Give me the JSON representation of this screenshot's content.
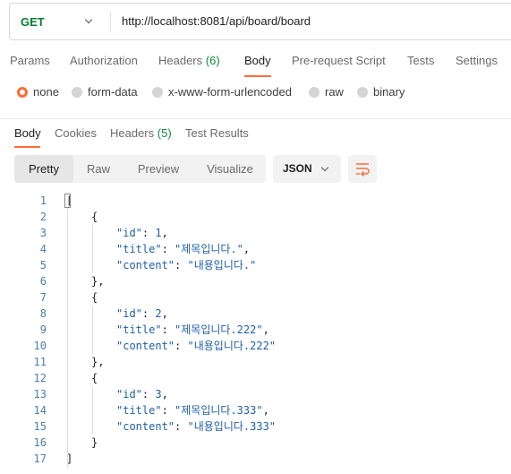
{
  "request": {
    "method": "GET",
    "url": "http://localhost:8081/api/board/board"
  },
  "request_tabs": [
    {
      "label": "Params"
    },
    {
      "label": "Authorization"
    },
    {
      "label": "Headers",
      "count": "(6)"
    },
    {
      "label": "Body"
    },
    {
      "label": "Pre-request Script"
    },
    {
      "label": "Tests"
    },
    {
      "label": "Settings"
    }
  ],
  "body_types": [
    "none",
    "form-data",
    "x-www-form-urlencoded",
    "raw",
    "binary"
  ],
  "response_tabs": [
    {
      "label": "Body"
    },
    {
      "label": "Cookies"
    },
    {
      "label": "Headers",
      "count": "(5)"
    },
    {
      "label": "Test Results"
    }
  ],
  "view_modes": [
    "Pretty",
    "Raw",
    "Preview",
    "Visualize"
  ],
  "format": "JSON",
  "response_lines": [
    {
      "n": "1",
      "text": "["
    },
    {
      "n": "2",
      "text": "{"
    },
    {
      "n": "3",
      "key": "\"id\"",
      "sep": ": ",
      "val": "1",
      "tail": ","
    },
    {
      "n": "4",
      "key": "\"title\"",
      "sep": ": ",
      "val": "\"제목입니다.\"",
      "tail": ","
    },
    {
      "n": "5",
      "key": "\"content\"",
      "sep": ": ",
      "val": "\"내용입니다.\"",
      "tail": ""
    },
    {
      "n": "6",
      "text": "},"
    },
    {
      "n": "7",
      "text": "{"
    },
    {
      "n": "8",
      "key": "\"id\"",
      "sep": ": ",
      "val": "2",
      "tail": ","
    },
    {
      "n": "9",
      "key": "\"title\"",
      "sep": ": ",
      "val": "\"제목입니다.222\"",
      "tail": ","
    },
    {
      "n": "10",
      "key": "\"content\"",
      "sep": ": ",
      "val": "\"내용입니다.222\"",
      "tail": ""
    },
    {
      "n": "11",
      "text": "},"
    },
    {
      "n": "12",
      "text": "{"
    },
    {
      "n": "13",
      "key": "\"id\"",
      "sep": ": ",
      "val": "3",
      "tail": ","
    },
    {
      "n": "14",
      "key": "\"title\"",
      "sep": ": ",
      "val": "\"제목입니다.333\"",
      "tail": ","
    },
    {
      "n": "15",
      "key": "\"content\"",
      "sep": ": ",
      "val": "\"내용입니다.333\"",
      "tail": ""
    },
    {
      "n": "16",
      "text": "}"
    },
    {
      "n": "17",
      "text": "]"
    }
  ],
  "colors": {
    "accent": "#ff6c37",
    "method": "#007f31",
    "json_value": "#1f5fa6",
    "line_number": "#4a7fab",
    "count": "#0f8a3b"
  },
  "icons": {
    "method_dropdown": "chevron-down-icon",
    "format_dropdown": "chevron-down-icon",
    "wrap": "wrap-lines-icon"
  }
}
